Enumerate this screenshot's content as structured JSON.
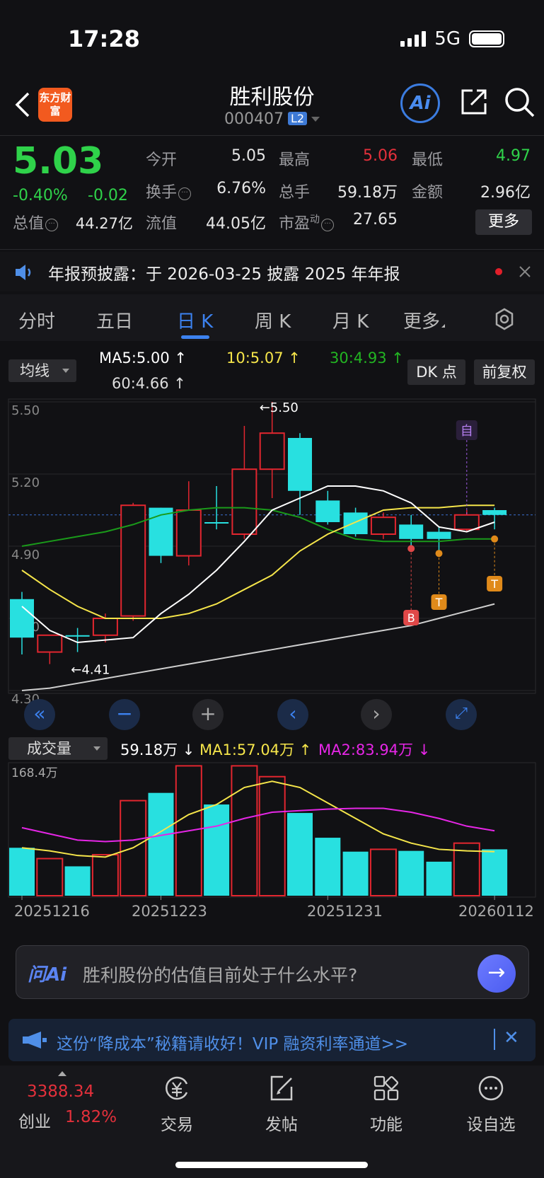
{
  "status": {
    "time": "17:28",
    "network": "5G"
  },
  "nav": {
    "logo_text": "东方财富",
    "stock_name": "胜利股份",
    "stock_code": "000407",
    "level_badge": "L2",
    "ai_label": "Ai"
  },
  "quote": {
    "price": "5.03",
    "change_pct": "-0.40%",
    "change": "-0.02",
    "open_label": "今开",
    "open": "5.05",
    "high_label": "最高",
    "high": "5.06",
    "low_label": "最低",
    "low": "4.97",
    "turnover_label": "换手",
    "turnover": "6.76%",
    "volume_label": "总手",
    "volume": "59.18万",
    "amount_label": "金额",
    "amount": "2.96亿",
    "mktcap_label": "总值",
    "mktcap": "44.27亿",
    "float_label": "流值",
    "float_cap": "44.05亿",
    "pe_label": "市盈",
    "pe_sup": "动",
    "pe": "27.65",
    "more_label": "更多"
  },
  "notice": {
    "text": "年报预披露：于 2026-03-25 披露 2025 年年报"
  },
  "tabs": [
    {
      "label": "分时"
    },
    {
      "label": "五日"
    },
    {
      "label": "日 K"
    },
    {
      "label": "周 K"
    },
    {
      "label": "月 K"
    },
    {
      "label": "更多"
    }
  ],
  "ma_bar": {
    "select_label": "均线",
    "ma5": "MA5:5.00 ↑",
    "ma10": "10:5.07 ↑",
    "ma30": "30:4.93 ↑",
    "ma60": "60:4.66 ↑",
    "dk_label": "DK 点",
    "fq_label": "前复权"
  },
  "colors": {
    "up": "#e2262f",
    "down": "#28e0e0",
    "ma5": "#ffffff",
    "ma10": "#f5e54a",
    "ma30": "#1a9a1a",
    "ma60": "#cfcfcf",
    "accent": "#3c82f0"
  },
  "chart_data": {
    "type": "candlestick",
    "y_ticks": [
      "5.50",
      "5.20",
      "4.90",
      "4.60",
      "4.30"
    ],
    "ylim": [
      4.3,
      5.5
    ],
    "annotations": {
      "high_marker": "←5.50",
      "low_marker": "←4.41",
      "marker_b": "B",
      "marker_t1": "T",
      "marker_t2": "T",
      "marker_self": "自"
    },
    "candles": [
      {
        "o": 4.68,
        "h": 4.71,
        "l": 4.45,
        "c": 4.52
      },
      {
        "o": 4.46,
        "h": 4.53,
        "l": 4.41,
        "c": 4.53
      },
      {
        "o": 4.53,
        "h": 4.56,
        "l": 4.46,
        "c": 4.53
      },
      {
        "o": 4.53,
        "h": 4.62,
        "l": 4.5,
        "c": 4.6
      },
      {
        "o": 4.61,
        "h": 5.08,
        "l": 4.59,
        "c": 5.07
      },
      {
        "o": 5.06,
        "h": 5.06,
        "l": 4.83,
        "c": 4.86
      },
      {
        "o": 4.86,
        "h": 5.17,
        "l": 4.82,
        "c": 5.05
      },
      {
        "o": 5.0,
        "h": 5.15,
        "l": 4.97,
        "c": 5.0
      },
      {
        "o": 4.95,
        "h": 5.4,
        "l": 4.93,
        "c": 5.22
      },
      {
        "o": 5.22,
        "h": 5.5,
        "l": 5.1,
        "c": 5.37
      },
      {
        "o": 5.35,
        "h": 5.37,
        "l": 5.03,
        "c": 5.13
      },
      {
        "o": 5.09,
        "h": 5.13,
        "l": 4.99,
        "c": 5.0
      },
      {
        "o": 5.04,
        "h": 5.06,
        "l": 4.94,
        "c": 4.95
      },
      {
        "o": 4.95,
        "h": 5.04,
        "l": 4.93,
        "c": 5.02
      },
      {
        "o": 4.99,
        "h": 5.03,
        "l": 4.89,
        "c": 4.93
      },
      {
        "o": 4.96,
        "h": 4.98,
        "l": 4.88,
        "c": 4.93
      },
      {
        "o": 4.97,
        "h": 5.05,
        "l": 4.96,
        "c": 5.03
      },
      {
        "o": 5.05,
        "h": 5.06,
        "l": 4.97,
        "c": 5.03
      }
    ],
    "ma5": [
      4.65,
      4.55,
      4.5,
      4.51,
      4.52,
      4.62,
      4.7,
      4.8,
      4.92,
      5.05,
      5.1,
      5.15,
      5.15,
      5.13,
      5.08,
      4.98,
      4.96,
      5.0
    ],
    "ma10": [
      4.8,
      4.72,
      4.65,
      4.6,
      4.6,
      4.6,
      4.62,
      4.66,
      4.72,
      4.78,
      4.88,
      4.95,
      5.0,
      5.05,
      5.06,
      5.06,
      5.07,
      5.07
    ],
    "ma30": [
      4.9,
      4.92,
      4.94,
      4.96,
      4.99,
      5.03,
      5.05,
      5.06,
      5.06,
      5.05,
      5.02,
      4.97,
      4.93,
      4.92,
      4.92,
      4.92,
      4.93,
      4.93
    ],
    "ma60": [
      4.3,
      4.31,
      4.33,
      4.35,
      4.37,
      4.39,
      4.41,
      4.43,
      4.45,
      4.47,
      4.49,
      4.51,
      4.53,
      4.55,
      4.57,
      4.6,
      4.63,
      4.66
    ]
  },
  "volume": {
    "select_label": "成交量",
    "current": "59.18万 ↓",
    "ma1": "MA1:57.04万 ↑",
    "ma2": "MA2:83.94万 ↓",
    "max_label": "168.4万",
    "bars": [
      62,
      48,
      38,
      53,
      123,
      133,
      168,
      118,
      168,
      154,
      107,
      75,
      57,
      60,
      58,
      44,
      68,
      60
    ],
    "ma1_line": [
      62,
      58,
      52,
      50,
      62,
      83,
      105,
      118,
      140,
      148,
      140,
      120,
      100,
      80,
      68,
      60,
      58,
      57
    ],
    "ma2_line": [
      88,
      80,
      72,
      70,
      72,
      78,
      84,
      90,
      100,
      108,
      110,
      112,
      113,
      113,
      108,
      100,
      90,
      84
    ],
    "vmax": 168.4
  },
  "x_dates": [
    "20251216",
    "20251223",
    "20251231",
    "20260112"
  ],
  "ask": {
    "logo": "问Ai",
    "text": "胜利股份的估值目前处于什么水平?"
  },
  "ad": {
    "text": "这份“降成本”秘籍请收好！VIP 融资利率通道>>"
  },
  "bottom_nav": {
    "index_value": "3388.34",
    "index_name": "创业",
    "index_pct": "1.82%",
    "items": [
      {
        "label": "交易"
      },
      {
        "label": "发帖"
      },
      {
        "label": "功能"
      },
      {
        "label": "设自选"
      }
    ]
  }
}
